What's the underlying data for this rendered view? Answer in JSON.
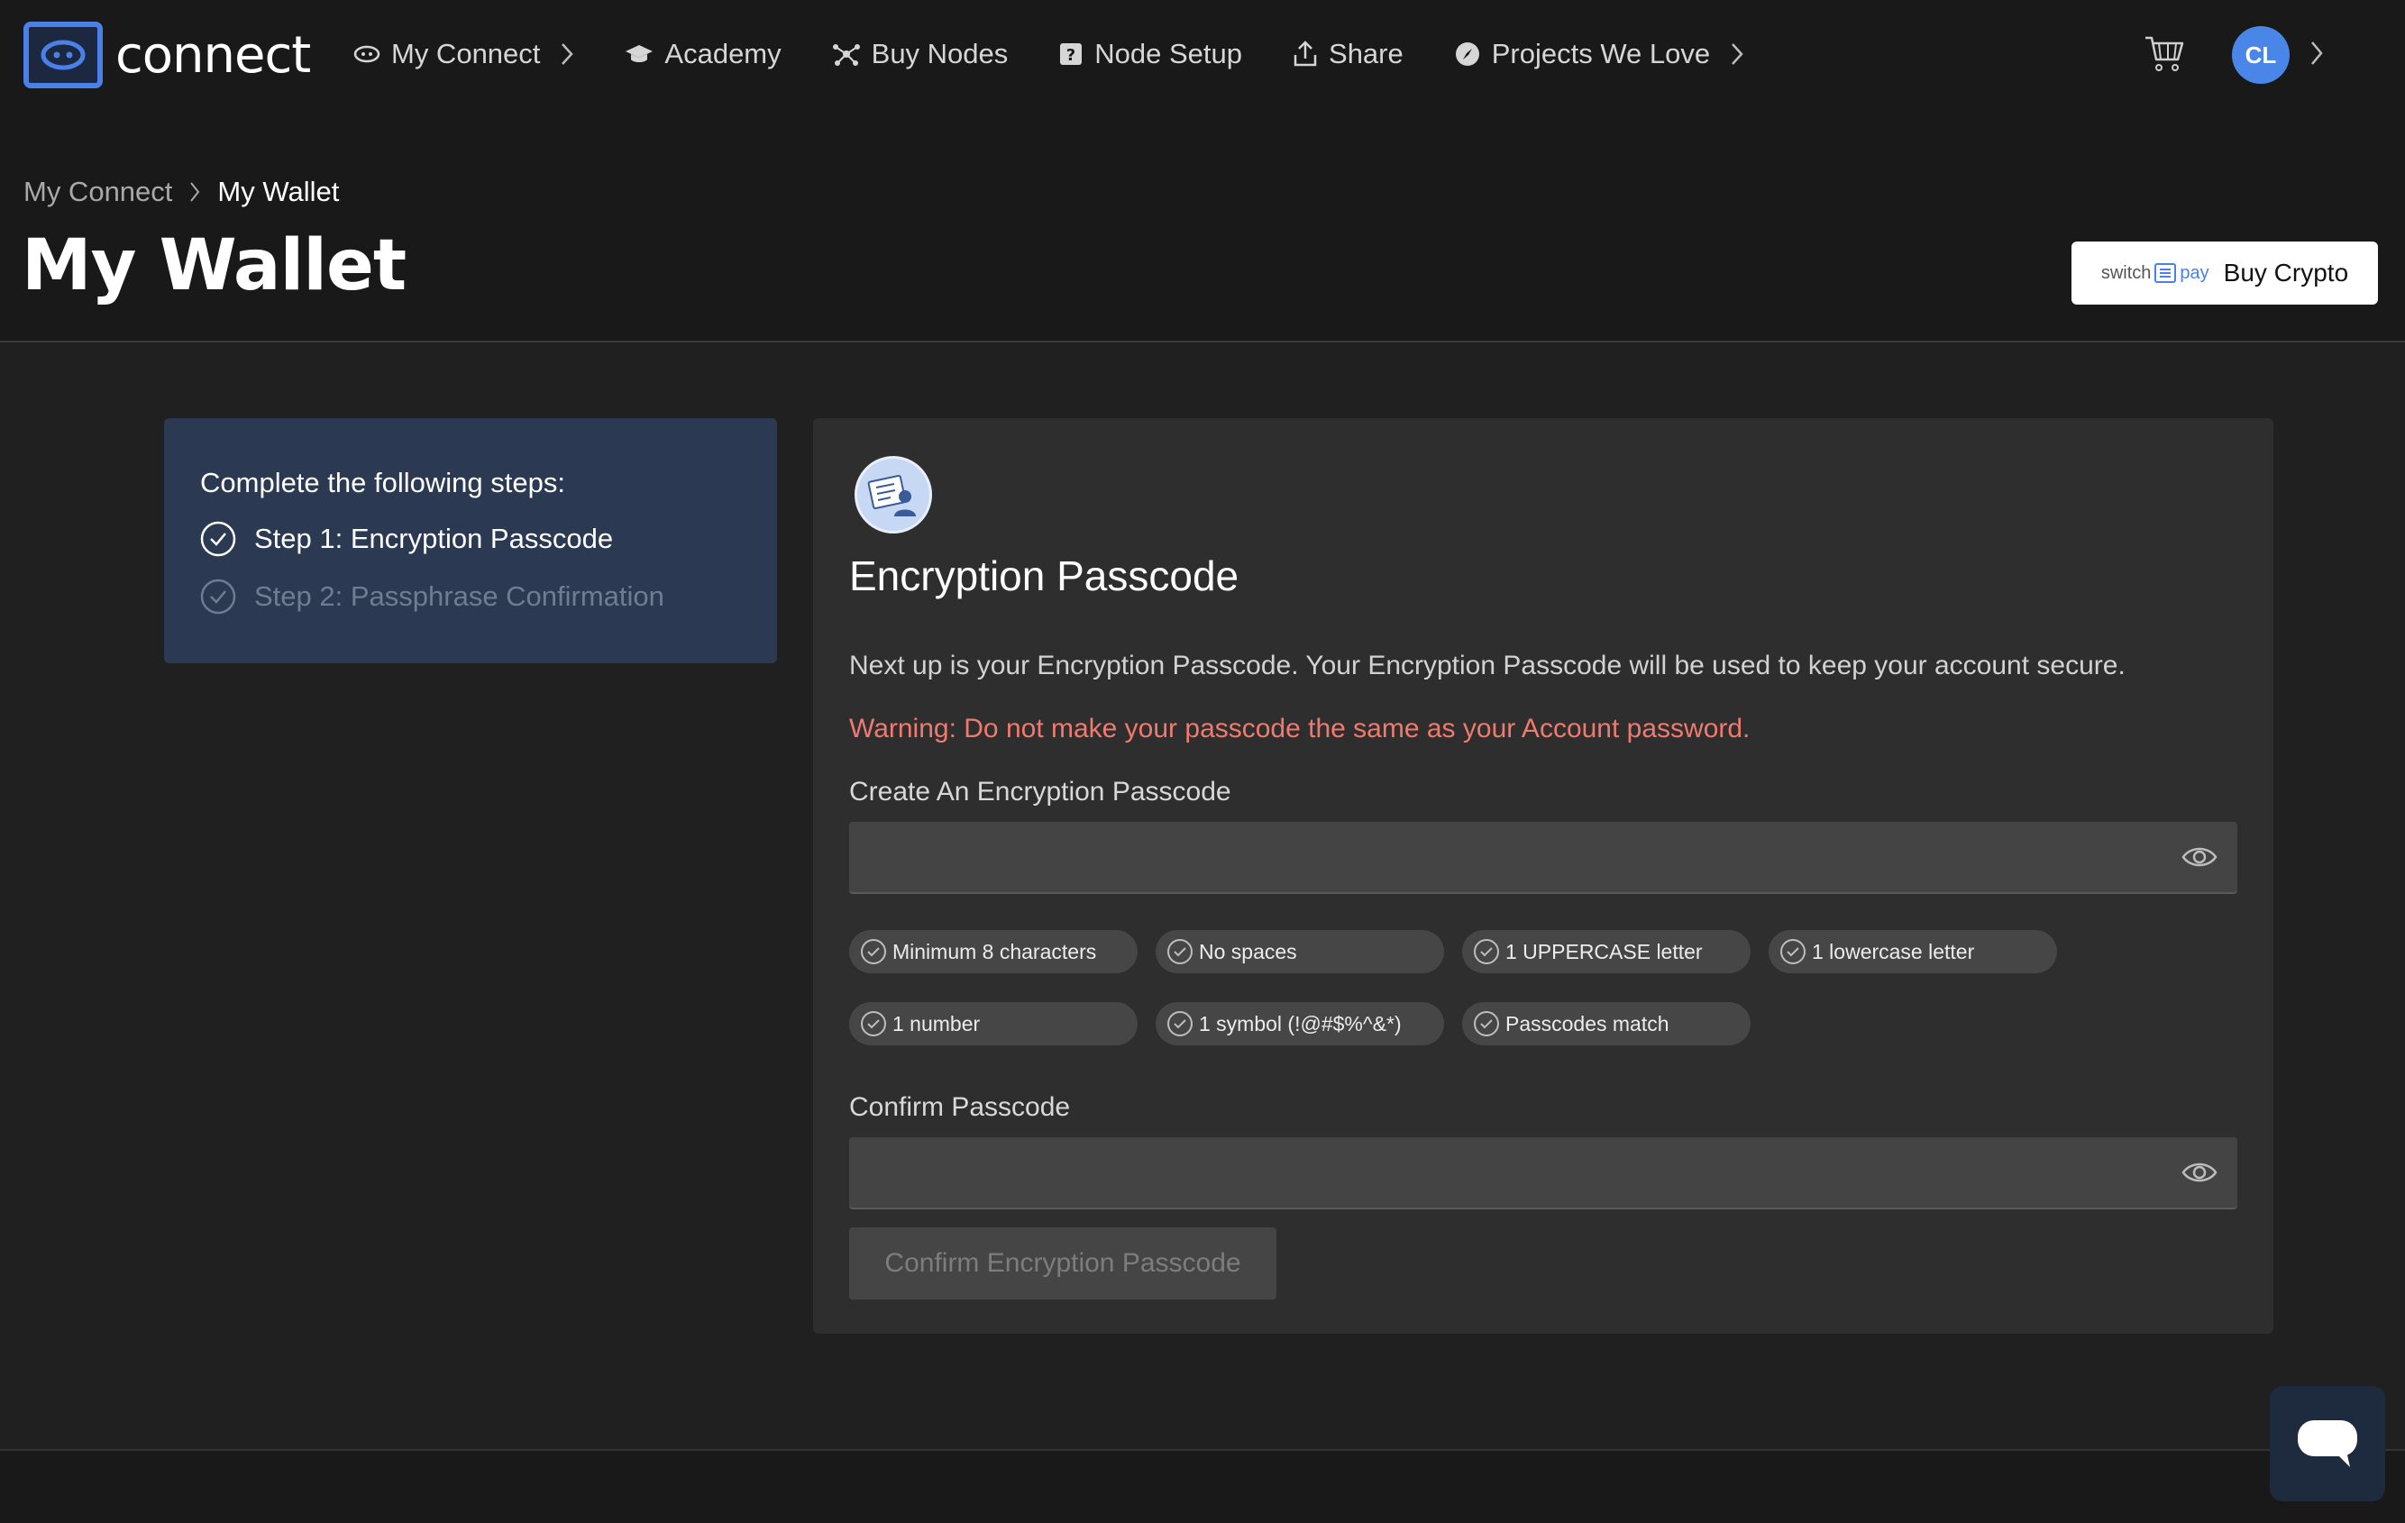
{
  "brand": {
    "name": "connect",
    "logo_icon": "eye-logo-icon",
    "accent": "#4a80e8"
  },
  "nav": {
    "items": [
      {
        "label": "My Connect",
        "icon": "eye-icon",
        "has_chevron": true
      },
      {
        "label": "Academy",
        "icon": "graduation-cap-icon",
        "has_chevron": false
      },
      {
        "label": "Buy Nodes",
        "icon": "nodes-icon",
        "has_chevron": false
      },
      {
        "label": "Node Setup",
        "icon": "help-box-icon",
        "has_chevron": false
      },
      {
        "label": "Share",
        "icon": "upload-icon",
        "has_chevron": false
      },
      {
        "label": "Projects We Love",
        "icon": "compass-icon",
        "has_chevron": true
      }
    ],
    "cart_icon": "cart-icon",
    "avatar_initials": "CL"
  },
  "breadcrumb": {
    "parent": "My Connect",
    "current": "My Wallet"
  },
  "page": {
    "title": "My Wallet",
    "buy_crypto": {
      "partner_prefix": "switch",
      "partner_suffix": "pay",
      "label": "Buy Crypto"
    }
  },
  "steps": {
    "title": "Complete the following steps:",
    "items": [
      {
        "label": "Step 1: Encryption Passcode",
        "active": true
      },
      {
        "label": "Step 2: Passphrase Confirmation",
        "active": false
      }
    ]
  },
  "encryption": {
    "title": "Encryption Passcode",
    "description": "Next up is your Encryption Passcode. Your Encryption Passcode will be used to keep your account secure.",
    "warning": "Warning: Do not make your passcode the same as your Account password.",
    "warning_color": "#f07a6e",
    "create_label": "Create An Encryption Passcode",
    "create_value": "",
    "confirm_label": "Confirm Passcode",
    "confirm_value": "",
    "requirements": [
      "Minimum 8 characters",
      "No spaces",
      "1 UPPERCASE letter",
      "1 lowercase letter",
      "1 number",
      "1 symbol (!@#$%^&*)",
      "Passcodes match"
    ],
    "submit_label": "Confirm Encryption Passcode"
  },
  "chat": {
    "icon": "chat-bubble-icon"
  }
}
